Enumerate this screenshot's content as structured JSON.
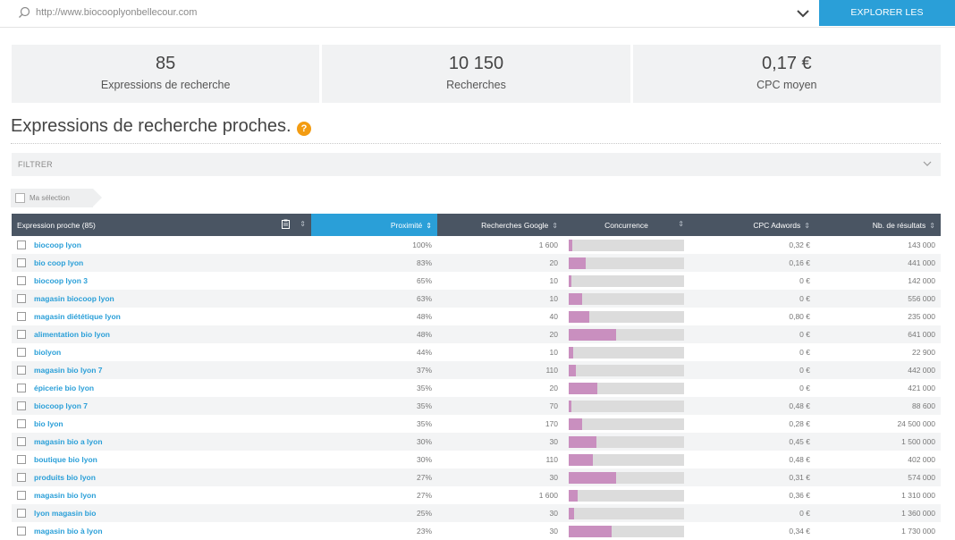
{
  "topbar": {
    "url": "http://www.biocooplyonbellecour.com",
    "explore_label": "EXPLORER LES RECHERCHES",
    "icons": [
      "search-icon",
      "chevron-down-icon"
    ]
  },
  "stats": [
    {
      "value": "85",
      "label": "Expressions de recherche"
    },
    {
      "value": "10 150",
      "label": "Recherches"
    },
    {
      "value": "0,17 €",
      "label": "CPC moyen"
    }
  ],
  "section": {
    "title": "Expressions de recherche proches.",
    "help": "?"
  },
  "filter": {
    "label": "FILTRER"
  },
  "selection": {
    "label": "Ma sélection"
  },
  "colors": {
    "accent": "#2a9fd8",
    "header": "#4a5563",
    "bar": "#c98fbf",
    "help": "#f39c12"
  },
  "table": {
    "headers": {
      "expression": "Expression proche (85)",
      "proximite": "Proximité",
      "recherches": "Recherches Google",
      "concurrence": "Concurrence",
      "cpc": "CPC Adwords",
      "resultats": "Nb. de résultats"
    },
    "rows": [
      {
        "kw": "biocoop lyon",
        "prox": "100%",
        "rech": "1 600",
        "conc": 0.03,
        "cpc": "0,32 €",
        "res": "143 000"
      },
      {
        "kw": "bio coop lyon",
        "prox": "83%",
        "rech": "20",
        "conc": 0.15,
        "cpc": "0,16 €",
        "res": "441 000"
      },
      {
        "kw": "biocoop lyon 3",
        "prox": "65%",
        "rech": "10",
        "conc": 0.0,
        "cpc": "0 €",
        "res": "142 000"
      },
      {
        "kw": "magasin biocoop lyon",
        "prox": "63%",
        "rech": "10",
        "conc": 0.12,
        "cpc": "0 €",
        "res": "556 000"
      },
      {
        "kw": "magasin diététique lyon",
        "prox": "48%",
        "rech": "40",
        "conc": 0.18,
        "cpc": "0,80 €",
        "res": "235 000"
      },
      {
        "kw": "alimentation bio lyon",
        "prox": "48%",
        "rech": "20",
        "conc": 0.41,
        "cpc": "0 €",
        "res": "641 000"
      },
      {
        "kw": "biolyon",
        "prox": "44%",
        "rech": "10",
        "conc": 0.04,
        "cpc": "0 €",
        "res": "22 900"
      },
      {
        "kw": "magasin bio lyon 7",
        "prox": "37%",
        "rech": "110",
        "conc": 0.06,
        "cpc": "0 €",
        "res": "442 000"
      },
      {
        "kw": "épicerie bio lyon",
        "prox": "35%",
        "rech": "20",
        "conc": 0.25,
        "cpc": "0 €",
        "res": "421 000"
      },
      {
        "kw": "biocoop lyon 7",
        "prox": "35%",
        "rech": "70",
        "conc": 0.0,
        "cpc": "0,48 €",
        "res": "88 600"
      },
      {
        "kw": "bio lyon",
        "prox": "35%",
        "rech": "170",
        "conc": 0.12,
        "cpc": "0,28 €",
        "res": "24 500 000"
      },
      {
        "kw": "magasin bio a lyon",
        "prox": "30%",
        "rech": "30",
        "conc": 0.24,
        "cpc": "0,45 €",
        "res": "1 500 000"
      },
      {
        "kw": "boutique bio lyon",
        "prox": "30%",
        "rech": "110",
        "conc": 0.21,
        "cpc": "0,48 €",
        "res": "402 000"
      },
      {
        "kw": "produits bio lyon",
        "prox": "27%",
        "rech": "30",
        "conc": 0.41,
        "cpc": "0,31 €",
        "res": "574 000"
      },
      {
        "kw": "magasin bio lyon",
        "prox": "27%",
        "rech": "1 600",
        "conc": 0.08,
        "cpc": "0,36 €",
        "res": "1 310 000"
      },
      {
        "kw": "lyon magasin bio",
        "prox": "25%",
        "rech": "30",
        "conc": 0.05,
        "cpc": "0 €",
        "res": "1 360 000"
      },
      {
        "kw": "magasin bio à lyon",
        "prox": "23%",
        "rech": "30",
        "conc": 0.37,
        "cpc": "0,34 €",
        "res": "1 730 000"
      }
    ]
  }
}
